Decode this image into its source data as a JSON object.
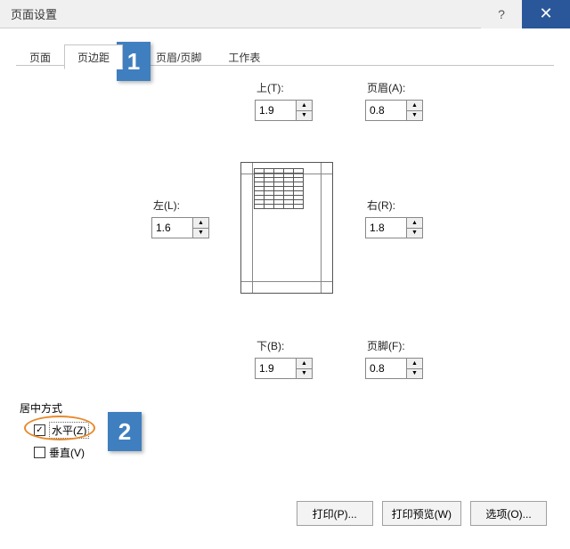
{
  "titlebar": {
    "title": "页面设置",
    "help": "?",
    "close": "✕"
  },
  "tabs": [
    {
      "label": "页面"
    },
    {
      "label": "页边距"
    },
    {
      "label": "页眉/页脚"
    },
    {
      "label": "工作表"
    }
  ],
  "margins": {
    "top": {
      "label": "上(T):",
      "value": "1.9"
    },
    "header": {
      "label": "页眉(A):",
      "value": "0.8"
    },
    "left": {
      "label": "左(L):",
      "value": "1.6"
    },
    "right": {
      "label": "右(R):",
      "value": "1.8"
    },
    "bottom": {
      "label": "下(B):",
      "value": "1.9"
    },
    "footer": {
      "label": "页脚(F):",
      "value": "0.8"
    }
  },
  "center": {
    "section": "居中方式",
    "horizontal": {
      "label": "水平(Z)",
      "checked": true
    },
    "vertical": {
      "label": "垂直(V)",
      "checked": false
    }
  },
  "buttons": {
    "print": "打印(P)...",
    "preview": "打印预览(W)",
    "options": "选项(O)..."
  },
  "callouts": {
    "one": "1",
    "two": "2"
  },
  "spin_glyphs": {
    "up": "▲",
    "down": "▼"
  }
}
